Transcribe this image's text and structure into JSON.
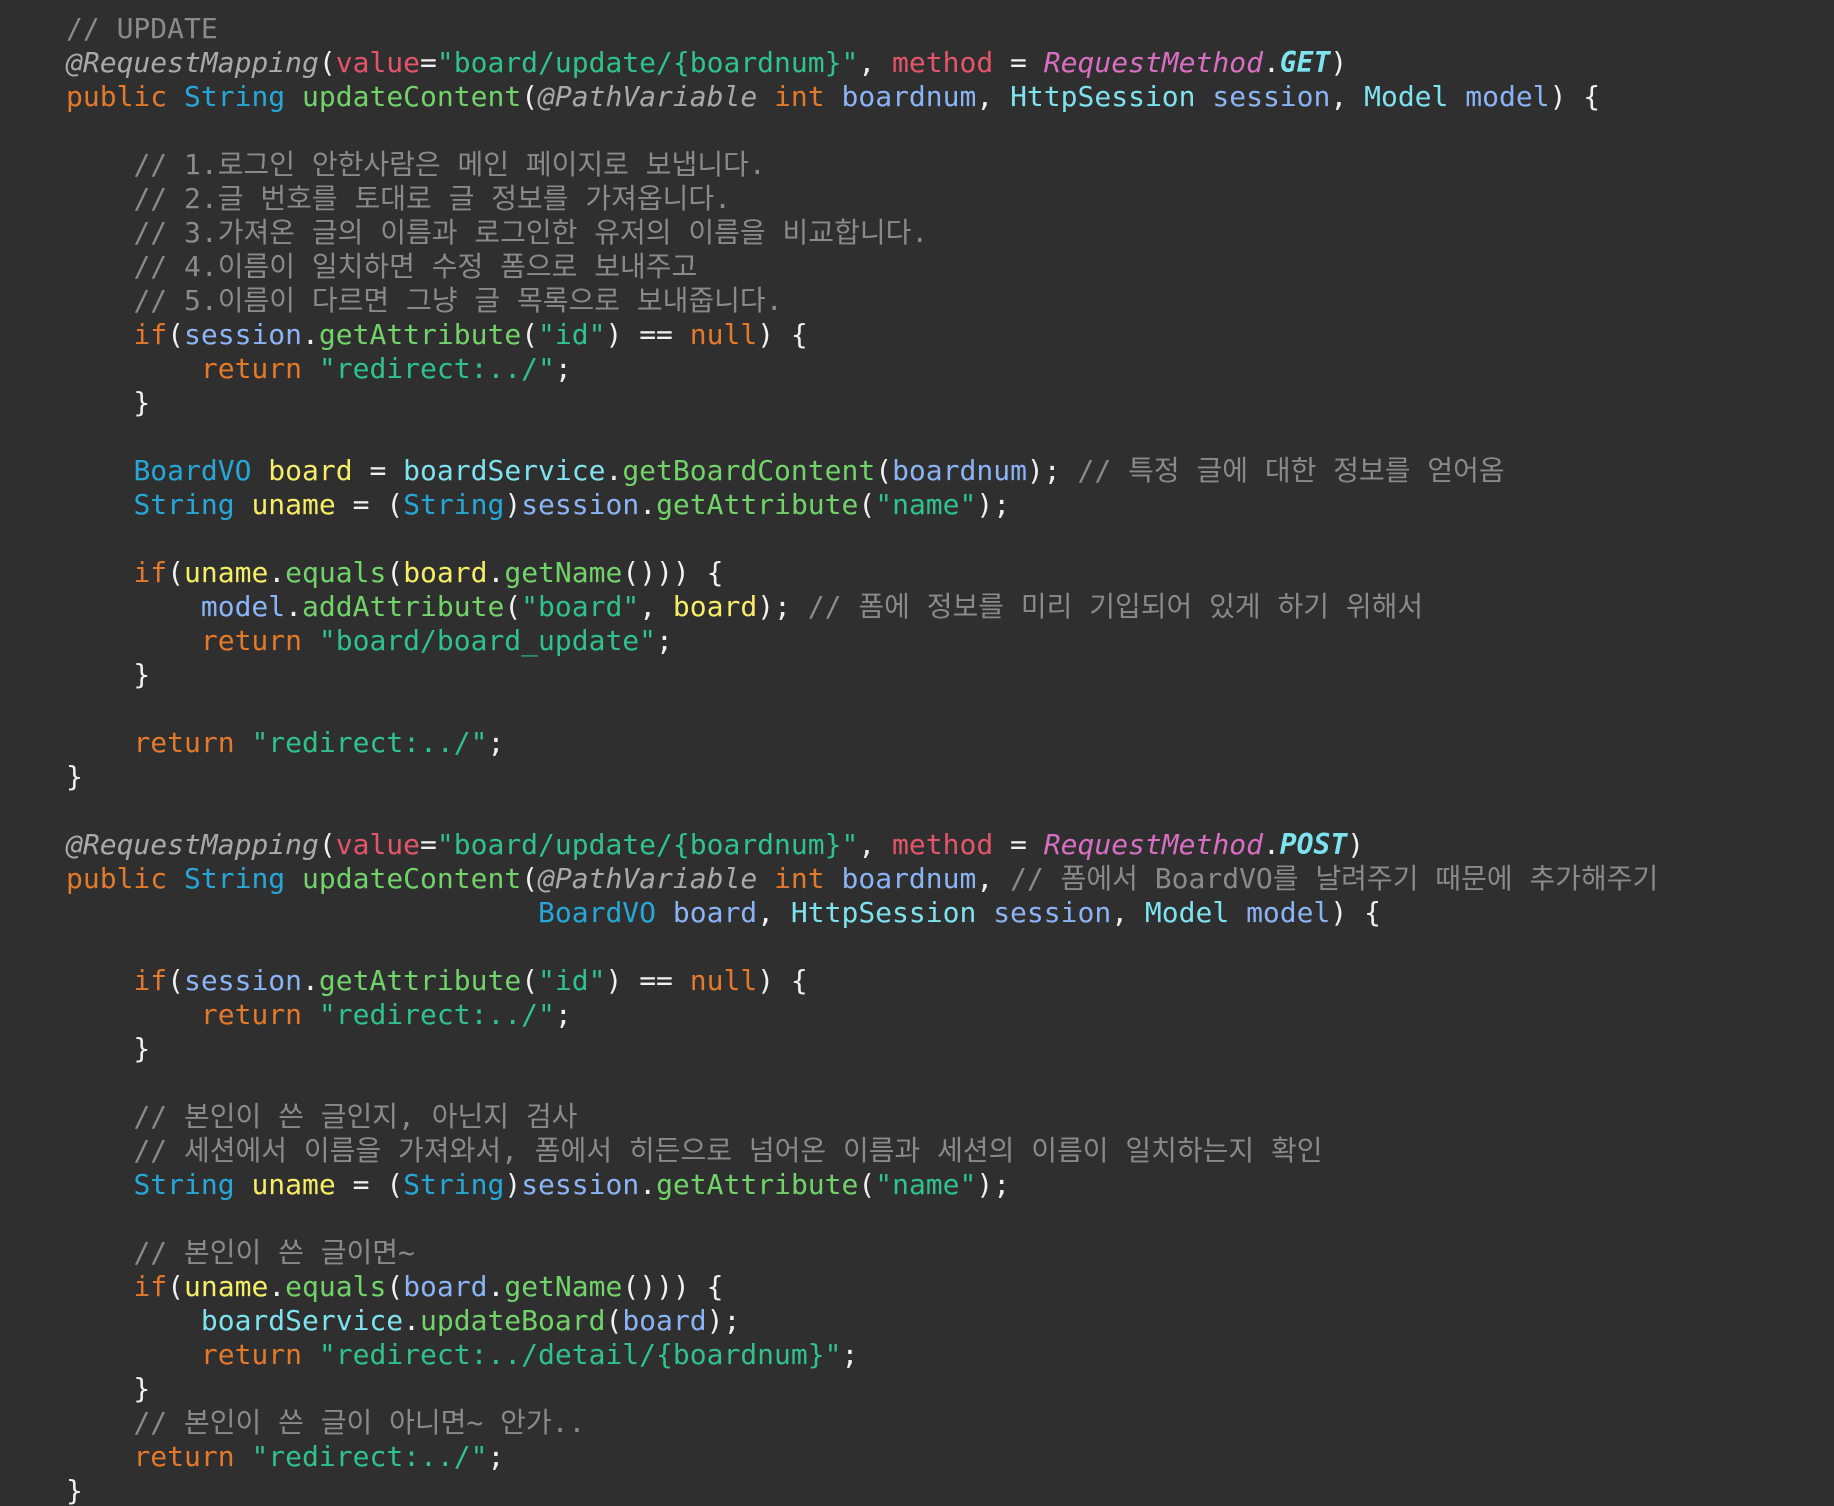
{
  "editor": {
    "theme_colors": {
      "background": "#2f2f2f",
      "comment": "#8a8a8a",
      "annotation": "#a9a9a9",
      "string": "#2fc28e",
      "keyword": "#e3792b",
      "type": "#27a7d8",
      "method": "#72d36a",
      "param": "#8bb4f7",
      "variable": "#f6ee67",
      "class": "#7ee3ee",
      "attribute_key": "#e4546b",
      "enum_type": "#d96fc2"
    },
    "lines": [
      [
        {
          "t": "comment",
          "v": "// UPDATE"
        }
      ],
      [
        {
          "t": "annot",
          "v": "@RequestMapping"
        },
        {
          "t": "plain",
          "v": "("
        },
        {
          "t": "attrkey",
          "v": "value"
        },
        {
          "t": "plain",
          "v": "="
        },
        {
          "t": "string",
          "v": "\"board/update/{boardnum}\""
        },
        {
          "t": "plain",
          "v": ", "
        },
        {
          "t": "attrkey",
          "v": "method"
        },
        {
          "t": "plain",
          "v": " = "
        },
        {
          "t": "enumtype",
          "v": "RequestMethod"
        },
        {
          "t": "plain",
          "v": "."
        },
        {
          "t": "enumconst",
          "v": "GET"
        },
        {
          "t": "plain",
          "v": ")"
        }
      ],
      [
        {
          "t": "keyword",
          "v": "public "
        },
        {
          "t": "type",
          "v": "String "
        },
        {
          "t": "method",
          "v": "updateContent"
        },
        {
          "t": "plain",
          "v": "("
        },
        {
          "t": "annot",
          "v": "@PathVariable "
        },
        {
          "t": "keyword",
          "v": "int "
        },
        {
          "t": "param",
          "v": "boardnum"
        },
        {
          "t": "plain",
          "v": ", "
        },
        {
          "t": "cyan",
          "v": "HttpSession "
        },
        {
          "t": "param",
          "v": "session"
        },
        {
          "t": "plain",
          "v": ", "
        },
        {
          "t": "cyan",
          "v": "Model "
        },
        {
          "t": "param",
          "v": "model"
        },
        {
          "t": "plain",
          "v": ") {"
        }
      ],
      [],
      [
        {
          "t": "plain",
          "v": "    "
        },
        {
          "t": "comment",
          "v": "// 1.로그인 안한사람은 메인 페이지로 보냅니다."
        }
      ],
      [
        {
          "t": "plain",
          "v": "    "
        },
        {
          "t": "comment",
          "v": "// 2.글 번호를 토대로 글 정보를 가져옵니다."
        }
      ],
      [
        {
          "t": "plain",
          "v": "    "
        },
        {
          "t": "comment",
          "v": "// 3.가져온 글의 이름과 로그인한 유저의 이름을 비교합니다."
        }
      ],
      [
        {
          "t": "plain",
          "v": "    "
        },
        {
          "t": "comment",
          "v": "// 4.이름이 일치하면 수정 폼으로 보내주고"
        }
      ],
      [
        {
          "t": "plain",
          "v": "    "
        },
        {
          "t": "comment",
          "v": "// 5.이름이 다르면 그냥 글 목록으로 보내줍니다."
        }
      ],
      [
        {
          "t": "plain",
          "v": "    "
        },
        {
          "t": "keyword",
          "v": "if"
        },
        {
          "t": "plain",
          "v": "("
        },
        {
          "t": "param",
          "v": "session"
        },
        {
          "t": "plain",
          "v": "."
        },
        {
          "t": "method",
          "v": "getAttribute"
        },
        {
          "t": "plain",
          "v": "("
        },
        {
          "t": "string",
          "v": "\"id\""
        },
        {
          "t": "plain",
          "v": ") == "
        },
        {
          "t": "keyword",
          "v": "null"
        },
        {
          "t": "plain",
          "v": ") {"
        }
      ],
      [
        {
          "t": "plain",
          "v": "        "
        },
        {
          "t": "keyword",
          "v": "return "
        },
        {
          "t": "string",
          "v": "\"redirect:../\""
        },
        {
          "t": "plain",
          "v": ";"
        }
      ],
      [
        {
          "t": "plain",
          "v": "    }"
        }
      ],
      [],
      [
        {
          "t": "plain",
          "v": "    "
        },
        {
          "t": "type",
          "v": "BoardVO "
        },
        {
          "t": "variable",
          "v": "board"
        },
        {
          "t": "plain",
          "v": " = "
        },
        {
          "t": "cyan",
          "v": "boardService"
        },
        {
          "t": "plain",
          "v": "."
        },
        {
          "t": "method",
          "v": "getBoardContent"
        },
        {
          "t": "plain",
          "v": "("
        },
        {
          "t": "param",
          "v": "boardnum"
        },
        {
          "t": "plain",
          "v": "); "
        },
        {
          "t": "comment",
          "v": "// 특정 글에 대한 정보를 얻어옴"
        }
      ],
      [
        {
          "t": "plain",
          "v": "    "
        },
        {
          "t": "type",
          "v": "String "
        },
        {
          "t": "variable",
          "v": "uname"
        },
        {
          "t": "plain",
          "v": " = ("
        },
        {
          "t": "type",
          "v": "String"
        },
        {
          "t": "plain",
          "v": ")"
        },
        {
          "t": "param",
          "v": "session"
        },
        {
          "t": "plain",
          "v": "."
        },
        {
          "t": "method",
          "v": "getAttribute"
        },
        {
          "t": "plain",
          "v": "("
        },
        {
          "t": "string",
          "v": "\"name\""
        },
        {
          "t": "plain",
          "v": ");"
        }
      ],
      [],
      [
        {
          "t": "plain",
          "v": "    "
        },
        {
          "t": "keyword",
          "v": "if"
        },
        {
          "t": "plain",
          "v": "("
        },
        {
          "t": "variable",
          "v": "uname"
        },
        {
          "t": "plain",
          "v": "."
        },
        {
          "t": "method",
          "v": "equals"
        },
        {
          "t": "plain",
          "v": "("
        },
        {
          "t": "variable",
          "v": "board"
        },
        {
          "t": "plain",
          "v": "."
        },
        {
          "t": "method",
          "v": "getName"
        },
        {
          "t": "plain",
          "v": "())) {"
        }
      ],
      [
        {
          "t": "plain",
          "v": "        "
        },
        {
          "t": "param",
          "v": "model"
        },
        {
          "t": "plain",
          "v": "."
        },
        {
          "t": "method",
          "v": "addAttribute"
        },
        {
          "t": "plain",
          "v": "("
        },
        {
          "t": "string",
          "v": "\"board\""
        },
        {
          "t": "plain",
          "v": ", "
        },
        {
          "t": "variable",
          "v": "board"
        },
        {
          "t": "plain",
          "v": "); "
        },
        {
          "t": "comment",
          "v": "// 폼에 정보를 미리 기입되어 있게 하기 위해서"
        }
      ],
      [
        {
          "t": "plain",
          "v": "        "
        },
        {
          "t": "keyword",
          "v": "return "
        },
        {
          "t": "string",
          "v": "\"board/board_update\""
        },
        {
          "t": "plain",
          "v": ";"
        }
      ],
      [
        {
          "t": "plain",
          "v": "    }"
        }
      ],
      [],
      [
        {
          "t": "plain",
          "v": "    "
        },
        {
          "t": "keyword",
          "v": "return "
        },
        {
          "t": "string",
          "v": "\"redirect:../\""
        },
        {
          "t": "plain",
          "v": ";"
        }
      ],
      [
        {
          "t": "plain",
          "v": "}"
        }
      ],
      [],
      [
        {
          "t": "annot",
          "v": "@RequestMapping"
        },
        {
          "t": "plain",
          "v": "("
        },
        {
          "t": "attrkey",
          "v": "value"
        },
        {
          "t": "plain",
          "v": "="
        },
        {
          "t": "string",
          "v": "\"board/update/{boardnum}\""
        },
        {
          "t": "plain",
          "v": ", "
        },
        {
          "t": "attrkey",
          "v": "method"
        },
        {
          "t": "plain",
          "v": " = "
        },
        {
          "t": "enumtype",
          "v": "RequestMethod"
        },
        {
          "t": "plain",
          "v": "."
        },
        {
          "t": "enumconst",
          "v": "POST"
        },
        {
          "t": "plain",
          "v": ")"
        }
      ],
      [
        {
          "t": "keyword",
          "v": "public "
        },
        {
          "t": "type",
          "v": "String "
        },
        {
          "t": "method",
          "v": "updateContent"
        },
        {
          "t": "plain",
          "v": "("
        },
        {
          "t": "annot",
          "v": "@PathVariable "
        },
        {
          "t": "keyword",
          "v": "int "
        },
        {
          "t": "param",
          "v": "boardnum"
        },
        {
          "t": "plain",
          "v": ", "
        },
        {
          "t": "comment",
          "v": "// 폼에서 BoardVO를 날려주기 때문에 추가해주기"
        }
      ],
      [
        {
          "t": "plain",
          "v": "                            "
        },
        {
          "t": "type",
          "v": "BoardVO "
        },
        {
          "t": "param",
          "v": "board"
        },
        {
          "t": "plain",
          "v": ", "
        },
        {
          "t": "cyan",
          "v": "HttpSession "
        },
        {
          "t": "param",
          "v": "session"
        },
        {
          "t": "plain",
          "v": ", "
        },
        {
          "t": "cyan",
          "v": "Model "
        },
        {
          "t": "param",
          "v": "model"
        },
        {
          "t": "plain",
          "v": ") {"
        }
      ],
      [],
      [
        {
          "t": "plain",
          "v": "    "
        },
        {
          "t": "keyword",
          "v": "if"
        },
        {
          "t": "plain",
          "v": "("
        },
        {
          "t": "param",
          "v": "session"
        },
        {
          "t": "plain",
          "v": "."
        },
        {
          "t": "method",
          "v": "getAttribute"
        },
        {
          "t": "plain",
          "v": "("
        },
        {
          "t": "string",
          "v": "\"id\""
        },
        {
          "t": "plain",
          "v": ") == "
        },
        {
          "t": "keyword",
          "v": "null"
        },
        {
          "t": "plain",
          "v": ") {"
        }
      ],
      [
        {
          "t": "plain",
          "v": "        "
        },
        {
          "t": "keyword",
          "v": "return "
        },
        {
          "t": "string",
          "v": "\"redirect:../\""
        },
        {
          "t": "plain",
          "v": ";"
        }
      ],
      [
        {
          "t": "plain",
          "v": "    }"
        }
      ],
      [],
      [
        {
          "t": "plain",
          "v": "    "
        },
        {
          "t": "comment",
          "v": "// 본인이 쓴 글인지, 아닌지 검사"
        }
      ],
      [
        {
          "t": "plain",
          "v": "    "
        },
        {
          "t": "comment",
          "v": "// 세션에서 이름을 가져와서, 폼에서 히든으로 넘어온 이름과 세션의 이름이 일치하는지 확인"
        }
      ],
      [
        {
          "t": "plain",
          "v": "    "
        },
        {
          "t": "type",
          "v": "String "
        },
        {
          "t": "variable",
          "v": "uname"
        },
        {
          "t": "plain",
          "v": " = ("
        },
        {
          "t": "type",
          "v": "String"
        },
        {
          "t": "plain",
          "v": ")"
        },
        {
          "t": "param",
          "v": "session"
        },
        {
          "t": "plain",
          "v": "."
        },
        {
          "t": "method",
          "v": "getAttribute"
        },
        {
          "t": "plain",
          "v": "("
        },
        {
          "t": "string",
          "v": "\"name\""
        },
        {
          "t": "plain",
          "v": ");"
        }
      ],
      [],
      [
        {
          "t": "plain",
          "v": "    "
        },
        {
          "t": "comment",
          "v": "// 본인이 쓴 글이면~"
        }
      ],
      [
        {
          "t": "plain",
          "v": "    "
        },
        {
          "t": "keyword",
          "v": "if"
        },
        {
          "t": "plain",
          "v": "("
        },
        {
          "t": "variable",
          "v": "uname"
        },
        {
          "t": "plain",
          "v": "."
        },
        {
          "t": "method",
          "v": "equals"
        },
        {
          "t": "plain",
          "v": "("
        },
        {
          "t": "param",
          "v": "board"
        },
        {
          "t": "plain",
          "v": "."
        },
        {
          "t": "method",
          "v": "getName"
        },
        {
          "t": "plain",
          "v": "())) {"
        }
      ],
      [
        {
          "t": "plain",
          "v": "        "
        },
        {
          "t": "cyan",
          "v": "boardService"
        },
        {
          "t": "plain",
          "v": "."
        },
        {
          "t": "method",
          "v": "updateBoard"
        },
        {
          "t": "plain",
          "v": "("
        },
        {
          "t": "param",
          "v": "board"
        },
        {
          "t": "plain",
          "v": ");"
        }
      ],
      [
        {
          "t": "plain",
          "v": "        "
        },
        {
          "t": "keyword",
          "v": "return "
        },
        {
          "t": "string",
          "v": "\"redirect:../detail/{boardnum}\""
        },
        {
          "t": "plain",
          "v": ";"
        }
      ],
      [
        {
          "t": "plain",
          "v": "    }"
        }
      ],
      [
        {
          "t": "plain",
          "v": "    "
        },
        {
          "t": "comment",
          "v": "// 본인이 쓴 글이 아니면~ 안가.."
        }
      ],
      [
        {
          "t": "plain",
          "v": "    "
        },
        {
          "t": "keyword",
          "v": "return "
        },
        {
          "t": "string",
          "v": "\"redirect:../\""
        },
        {
          "t": "plain",
          "v": ";"
        }
      ],
      [
        {
          "t": "plain",
          "v": "}"
        }
      ]
    ]
  }
}
